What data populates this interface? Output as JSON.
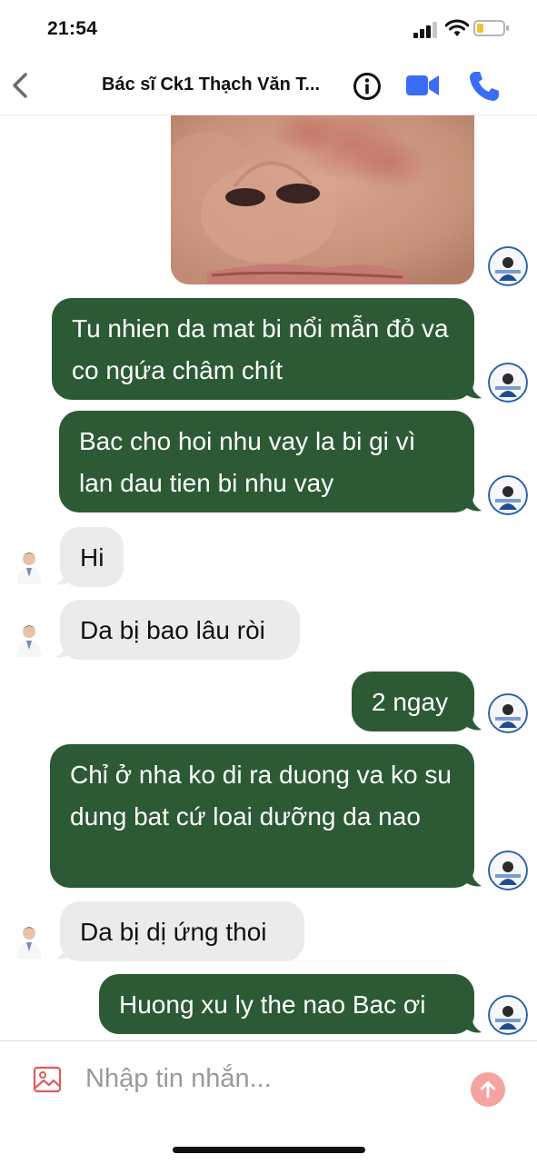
{
  "status_bar": {
    "time": "21:54"
  },
  "header": {
    "title": "Bác sĩ Ck1 Thạch Văn T..."
  },
  "messages": [
    {
      "text": "Tu nhien da mat bi nổi mẫn đỏ va co ngứa châm chít",
      "sender": "me"
    },
    {
      "text": "Bac cho hoi nhu vay la bi gi vì lan dau tien bi nhu vay",
      "sender": "me"
    },
    {
      "text": "Hi",
      "sender": "doctor"
    },
    {
      "text": "Da bị bao lâu ròi",
      "sender": "doctor"
    },
    {
      "text": "2 ngay",
      "sender": "me"
    },
    {
      "text": "Chỉ ở nha ko di ra duong va ko su dung bat cứ loai dưỡng da nao",
      "sender": "me"
    },
    {
      "text": "Da bị dị ứng thoi",
      "sender": "doctor"
    },
    {
      "text": "Huong xu ly the nao Bac ơi",
      "sender": "me"
    }
  ],
  "composer": {
    "placeholder": "Nhập tin nhắn..."
  },
  "colors": {
    "outgoing_bubble": "#2c5a35",
    "incoming_bubble": "#ebebeb",
    "accent": "#3b6cf6",
    "send_button": "#f4a3a0"
  },
  "icons": {
    "back": "chevron-left-icon",
    "info": "info-icon",
    "video": "video-camera-icon",
    "phone": "phone-icon",
    "attach": "image-icon",
    "send": "arrow-up-icon"
  }
}
